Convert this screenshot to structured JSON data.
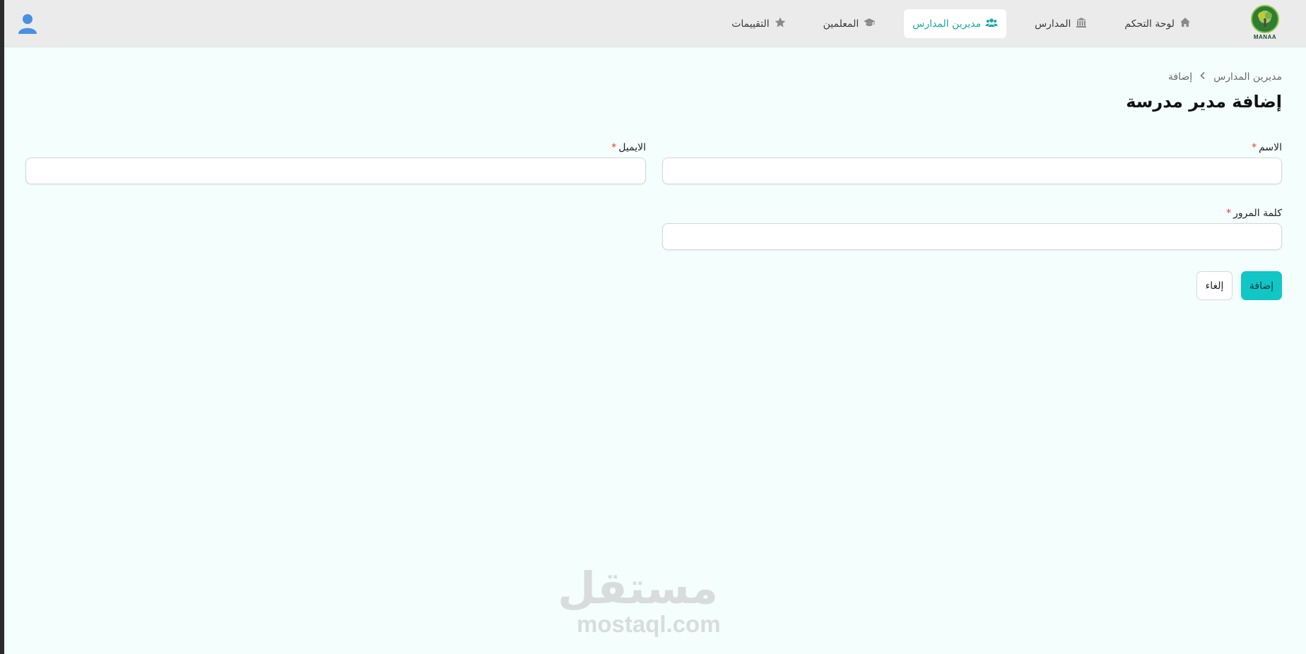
{
  "app": {
    "logo_text": "MANAA"
  },
  "nav": {
    "items": [
      {
        "label": "لوحة التحكم",
        "icon": "home-icon"
      },
      {
        "label": "المدارس",
        "icon": "building-columns-icon"
      },
      {
        "label": "مديرين المدارس",
        "icon": "users-icon",
        "active": true
      },
      {
        "label": "المعلمين",
        "icon": "graduation-cap-icon"
      },
      {
        "label": "التقييمات",
        "icon": "star-icon"
      }
    ]
  },
  "breadcrumb": {
    "parent": "مديرين المدارس",
    "current": "إضافة"
  },
  "page": {
    "title": "إضافة مدير مدرسة"
  },
  "form": {
    "name": {
      "label": "الاسم",
      "value": ""
    },
    "email": {
      "label": "الايميل",
      "value": ""
    },
    "password": {
      "label": "كلمة المرور",
      "value": ""
    },
    "required_mark": "*"
  },
  "actions": {
    "submit_label": "إضافة",
    "cancel_label": "إلغاء"
  },
  "watermark": {
    "arabic": "مستقل",
    "latin": "mostaql.com"
  },
  "colors": {
    "accent": "#12c6c6",
    "active_nav_text": "#1aa7a7",
    "required": "#e53935",
    "background": "#f3fefd"
  }
}
